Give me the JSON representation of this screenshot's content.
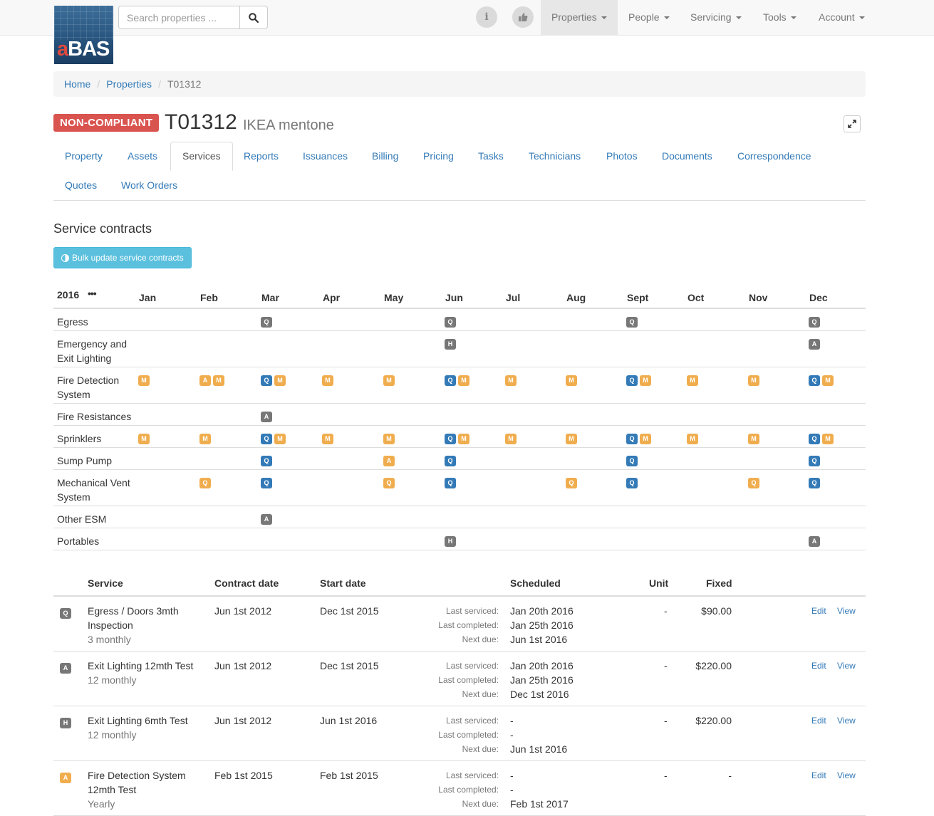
{
  "nav": {
    "logo_text_a": "a",
    "logo_text_rest": "BAS",
    "search_placeholder": "Search properties ...",
    "info_glyph": "i",
    "menu": [
      "Properties",
      "People",
      "Servicing",
      "Tools",
      "Account"
    ]
  },
  "breadcrumb": {
    "home": "Home",
    "properties": "Properties",
    "current": "T01312"
  },
  "status": {
    "label": "NON-COMPLIANT",
    "color": "#d9534f"
  },
  "title": {
    "code": "T01312",
    "name": "IKEA mentone"
  },
  "tabs": [
    "Property",
    "Assets",
    "Services",
    "Reports",
    "Issuances",
    "Billing",
    "Pricing",
    "Tasks",
    "Technicians",
    "Photos",
    "Documents",
    "Correspondence",
    "Quotes",
    "Work Orders"
  ],
  "active_tab": "Services",
  "section": {
    "title": "Service contracts",
    "bulk_button": "Bulk update service contracts"
  },
  "calendar": {
    "year": "2016",
    "ellipsis": "•••",
    "months": [
      "Jan",
      "Feb",
      "Mar",
      "Apr",
      "May",
      "Jun",
      "Jul",
      "Aug",
      "Sept",
      "Oct",
      "Nov",
      "Dec"
    ],
    "colors": {
      "blue": "#337ab7",
      "grey": "#777777",
      "orange": "#f0ad4e"
    },
    "rows": [
      {
        "name": "Egress",
        "cells": [
          [],
          [],
          [
            [
              "Q",
              "grey"
            ]
          ],
          [],
          [],
          [
            [
              "Q",
              "grey"
            ]
          ],
          [],
          [],
          [
            [
              "Q",
              "grey"
            ]
          ],
          [],
          [],
          [
            [
              "Q",
              "grey"
            ]
          ]
        ]
      },
      {
        "name": "Emergency and Exit Lighting",
        "cells": [
          [],
          [],
          [],
          [],
          [],
          [
            [
              "H",
              "grey"
            ]
          ],
          [],
          [],
          [],
          [],
          [],
          [
            [
              "A",
              "grey"
            ]
          ]
        ]
      },
      {
        "name": "Fire Detection System",
        "cells": [
          [
            [
              "M",
              "orange"
            ]
          ],
          [
            [
              "A",
              "orange"
            ],
            [
              "M",
              "orange"
            ]
          ],
          [
            [
              "Q",
              "blue"
            ],
            [
              "M",
              "orange"
            ]
          ],
          [
            [
              "M",
              "orange"
            ]
          ],
          [
            [
              "M",
              "orange"
            ]
          ],
          [
            [
              "Q",
              "blue"
            ],
            [
              "M",
              "orange"
            ]
          ],
          [
            [
              "M",
              "orange"
            ]
          ],
          [
            [
              "M",
              "orange"
            ]
          ],
          [
            [
              "Q",
              "blue"
            ],
            [
              "M",
              "orange"
            ]
          ],
          [
            [
              "M",
              "orange"
            ]
          ],
          [
            [
              "M",
              "orange"
            ]
          ],
          [
            [
              "Q",
              "blue"
            ],
            [
              "M",
              "orange"
            ]
          ]
        ]
      },
      {
        "name": "Fire Resistances",
        "cells": [
          [],
          [],
          [
            [
              "A",
              "grey"
            ]
          ],
          [],
          [],
          [],
          [],
          [],
          [],
          [],
          [],
          []
        ]
      },
      {
        "name": "Sprinklers",
        "cells": [
          [
            [
              "M",
              "orange"
            ]
          ],
          [
            [
              "M",
              "orange"
            ]
          ],
          [
            [
              "Q",
              "blue"
            ],
            [
              "M",
              "orange"
            ]
          ],
          [
            [
              "M",
              "orange"
            ]
          ],
          [
            [
              "M",
              "orange"
            ]
          ],
          [
            [
              "Q",
              "blue"
            ],
            [
              "M",
              "orange"
            ]
          ],
          [
            [
              "M",
              "orange"
            ]
          ],
          [
            [
              "M",
              "orange"
            ]
          ],
          [
            [
              "Q",
              "blue"
            ],
            [
              "M",
              "orange"
            ]
          ],
          [
            [
              "M",
              "orange"
            ]
          ],
          [
            [
              "M",
              "orange"
            ]
          ],
          [
            [
              "Q",
              "blue"
            ],
            [
              "M",
              "orange"
            ]
          ]
        ]
      },
      {
        "name": "Sump Pump",
        "cells": [
          [],
          [],
          [
            [
              "Q",
              "blue"
            ]
          ],
          [],
          [
            [
              "A",
              "orange"
            ]
          ],
          [
            [
              "Q",
              "blue"
            ]
          ],
          [],
          [],
          [
            [
              "Q",
              "blue"
            ]
          ],
          [],
          [],
          [
            [
              "Q",
              "blue"
            ]
          ]
        ]
      },
      {
        "name": "Mechanical Vent System",
        "cells": [
          [],
          [
            [
              "Q",
              "orange"
            ]
          ],
          [
            [
              "Q",
              "blue"
            ]
          ],
          [],
          [
            [
              "Q",
              "orange"
            ]
          ],
          [
            [
              "Q",
              "blue"
            ]
          ],
          [],
          [
            [
              "Q",
              "orange"
            ]
          ],
          [
            [
              "Q",
              "blue"
            ]
          ],
          [],
          [
            [
              "Q",
              "orange"
            ]
          ],
          [
            [
              "Q",
              "blue"
            ]
          ]
        ]
      },
      {
        "name": "Other ESM",
        "cells": [
          [],
          [],
          [
            [
              "A",
              "grey"
            ]
          ],
          [],
          [],
          [],
          [],
          [],
          [],
          [],
          [],
          []
        ]
      },
      {
        "name": "Portables",
        "cells": [
          [],
          [],
          [],
          [],
          [],
          [
            [
              "H",
              "grey"
            ]
          ],
          [],
          [],
          [],
          [],
          [],
          [
            [
              "A",
              "grey"
            ]
          ]
        ]
      }
    ]
  },
  "services": {
    "headers": {
      "service": "Service",
      "contract_date": "Contract date",
      "start_date": "Start date",
      "scheduled": "Scheduled",
      "unit": "Unit",
      "fixed": "Fixed"
    },
    "sched_labels": [
      "Last serviced:",
      "Last completed:",
      "Next due:"
    ],
    "edit_label": "Edit",
    "view_label": "View",
    "rows": [
      {
        "badge": "Q",
        "badge_color": "grey",
        "name": "Egress / Doors 3mth Inspection",
        "frequency": "3 monthly",
        "contract_date": "Jun 1st 2012",
        "start_date": "Dec 1st 2015",
        "last_serviced": "Jan 20th 2016",
        "last_completed": "Jan 25th 2016",
        "next_due": "Jun 1st 2016",
        "unit": "-",
        "fixed": "$90.00"
      },
      {
        "badge": "A",
        "badge_color": "grey",
        "name": "Exit Lighting 12mth Test",
        "frequency": "12 monthly",
        "contract_date": "Jun 1st 2012",
        "start_date": "Dec 1st 2015",
        "last_serviced": "Jan 20th 2016",
        "last_completed": "Jan 25th 2016",
        "next_due": "Dec 1st 2016",
        "unit": "-",
        "fixed": "$220.00"
      },
      {
        "badge": "H",
        "badge_color": "grey",
        "name": "Exit Lighting 6mth Test",
        "frequency": "12 monthly",
        "contract_date": "Jun 1st 2012",
        "start_date": "Jun 1st 2016",
        "last_serviced": "-",
        "last_completed": "-",
        "next_due": "Jun 1st 2016",
        "unit": "-",
        "fixed": "$220.00"
      },
      {
        "badge": "A",
        "badge_color": "orange",
        "name": "Fire Detection System 12mth Test",
        "frequency": "Yearly",
        "contract_date": "Feb 1st 2015",
        "start_date": "Feb 1st 2015",
        "last_serviced": "-",
        "last_completed": "-",
        "next_due": "Feb 1st 2017",
        "unit": "-",
        "fixed": "-"
      }
    ]
  }
}
